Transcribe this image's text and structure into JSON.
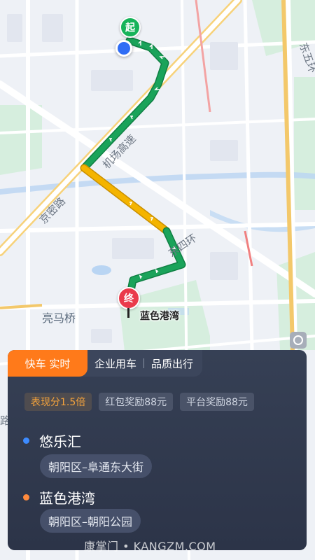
{
  "map": {
    "labels": {
      "road_airport_expressway": "机场高速",
      "road_jingmi": "京密路",
      "road_east_4th_ring": "东四环",
      "road_east_5th_ring": "东五环",
      "area_liangma_bridge": "亮马桥",
      "partial_left_1": "路"
    },
    "start_marker": "起",
    "end_marker": "终",
    "destination_label": "蓝色港湾"
  },
  "card": {
    "tabs": [
      {
        "label": "快车 实时",
        "active": true
      },
      {
        "label": "企业用车",
        "active": false
      },
      {
        "label": "品质出行",
        "active": false
      }
    ],
    "badges": [
      "表现分1.5倍",
      "红包奖励88元",
      "平台奖励88元"
    ],
    "pickup": {
      "name": "悠乐汇",
      "address": "朝阳区–阜通东大街",
      "dot_color": "#3d8bff"
    },
    "dropoff": {
      "name": "蓝色港湾",
      "address": "朝阳区–朝阳公园",
      "dot_color": "#ff8a3d"
    }
  },
  "watermark": "康掌门 • KANGZM.COM",
  "colors": {
    "route_green": "#1aa35a",
    "route_yellow": "#f4b400",
    "accent_orange": "#ff7a1a",
    "card_bg": "#333c50"
  }
}
